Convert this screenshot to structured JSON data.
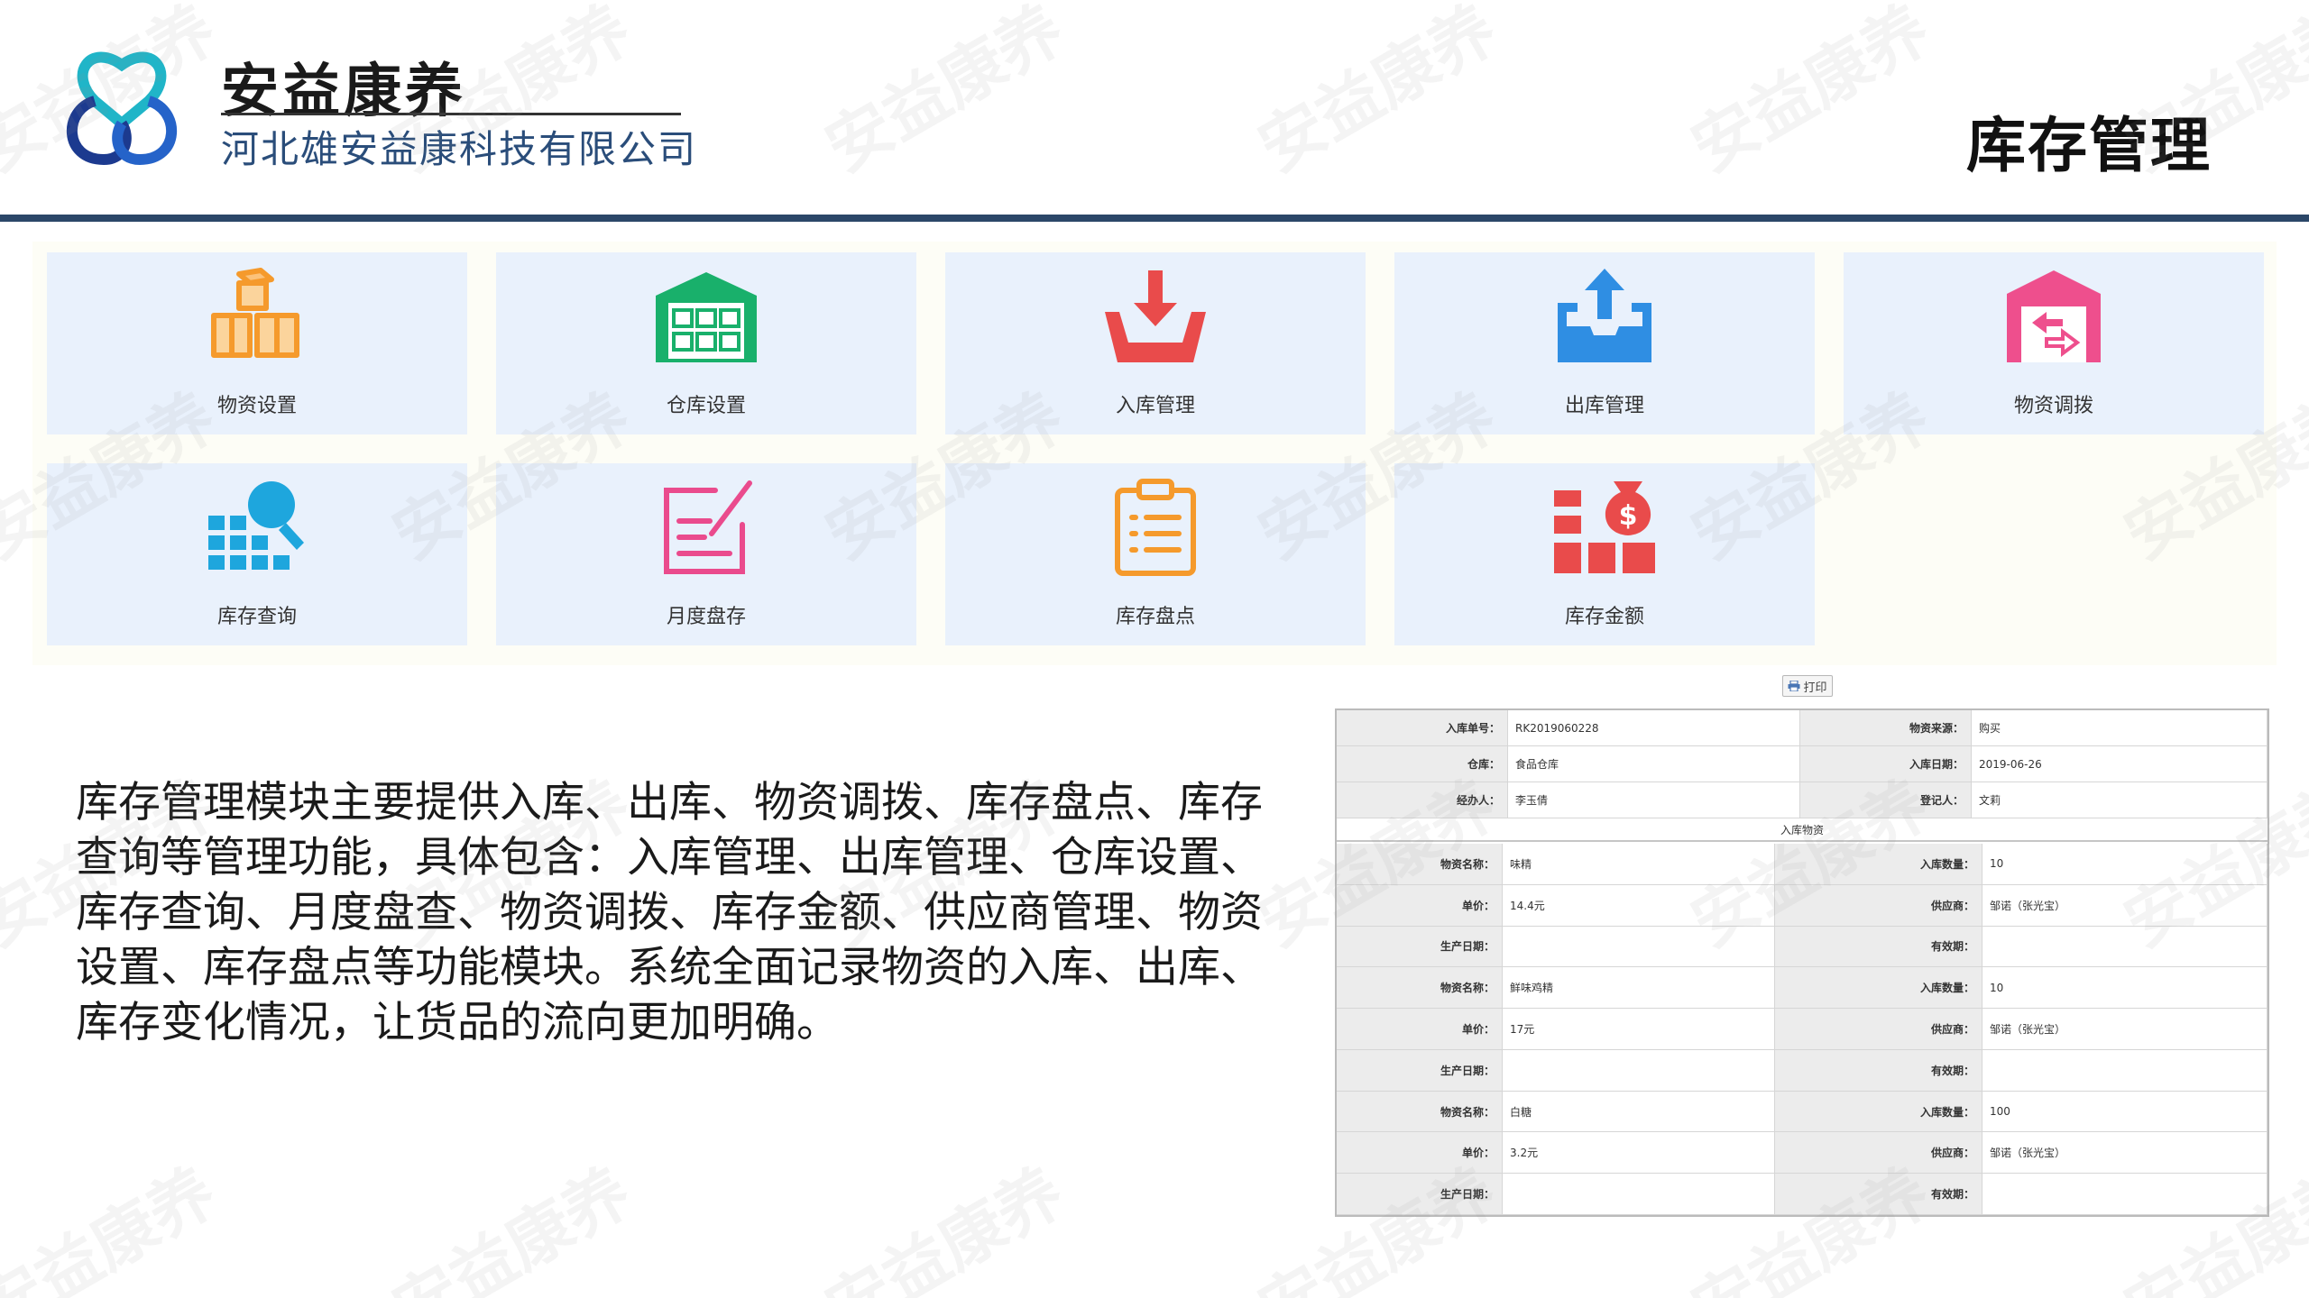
{
  "brand": {
    "name": "安益康养",
    "subtitle": "河北雄安益康科技有限公司"
  },
  "page_title": "库存管理",
  "watermark_text": "安益康养",
  "modules": [
    {
      "label": "物资设置",
      "icon": "boxes-icon",
      "color": "#f59a2c"
    },
    {
      "label": "仓库设置",
      "icon": "warehouse-icon",
      "color": "#19b06b"
    },
    {
      "label": "入库管理",
      "icon": "inbound-tray-icon",
      "color": "#e94b4b"
    },
    {
      "label": "出库管理",
      "icon": "outbound-tray-icon",
      "color": "#2f8ee3"
    },
    {
      "label": "物资调拨",
      "icon": "transfer-house-icon",
      "color": "#ee4f8d"
    },
    {
      "label": "库存查询",
      "icon": "search-blocks-icon",
      "color": "#1ea6dd"
    },
    {
      "label": "月度盘存",
      "icon": "edit-note-icon",
      "color": "#ea4b8d"
    },
    {
      "label": "库存盘点",
      "icon": "clipboard-list-icon",
      "color": "#f59a2c"
    },
    {
      "label": "库存金额",
      "icon": "money-bag-icon",
      "color": "#e94b4b"
    }
  ],
  "description": "库存管理模块主要提供入库、出库、物资调拨、库存盘点、库存查询等管理功能，具体包含：入库管理、出库管理、仓库设置、库存查询、月度盘查、物资调拨、库存金额、供应商管理、物资设置、库存盘点等功能模块。系统全面记录物资的入库、出库、库存变化情况，让货品的流向更加明确。",
  "form": {
    "print_label": "打印",
    "header_rows": [
      [
        {
          "label": "入库单号：",
          "value": "RK2019060228"
        },
        {
          "label": "物资来源：",
          "value": "购买"
        }
      ],
      [
        {
          "label": "仓库：",
          "value": "食品仓库"
        },
        {
          "label": "入库日期：",
          "value": "2019-06-26"
        }
      ],
      [
        {
          "label": "经办人：",
          "value": "李玉倩"
        },
        {
          "label": "登记人：",
          "value": "文莉"
        }
      ]
    ],
    "section_title": "入库物资",
    "item_rows": [
      [
        {
          "label": "物资名称：",
          "value": "味精"
        },
        {
          "label": "入库数量：",
          "value": "10"
        }
      ],
      [
        {
          "label": "单价：",
          "value": "14.4元"
        },
        {
          "label": "供应商：",
          "value": "邹诺（张光宝）"
        }
      ],
      [
        {
          "label": "生产日期：",
          "value": ""
        },
        {
          "label": "有效期：",
          "value": ""
        }
      ],
      [
        {
          "label": "物资名称：",
          "value": "鲜味鸡精"
        },
        {
          "label": "入库数量：",
          "value": "10"
        }
      ],
      [
        {
          "label": "单价：",
          "value": "17元"
        },
        {
          "label": "供应商：",
          "value": "邹诺（张光宝）"
        }
      ],
      [
        {
          "label": "生产日期：",
          "value": ""
        },
        {
          "label": "有效期：",
          "value": ""
        }
      ],
      [
        {
          "label": "物资名称：",
          "value": "白糖"
        },
        {
          "label": "入库数量：",
          "value": "100"
        }
      ],
      [
        {
          "label": "单价：",
          "value": "3.2元"
        },
        {
          "label": "供应商：",
          "value": "邹诺（张光宝）"
        }
      ],
      [
        {
          "label": "生产日期：",
          "value": ""
        },
        {
          "label": "有效期：",
          "value": ""
        }
      ]
    ]
  }
}
